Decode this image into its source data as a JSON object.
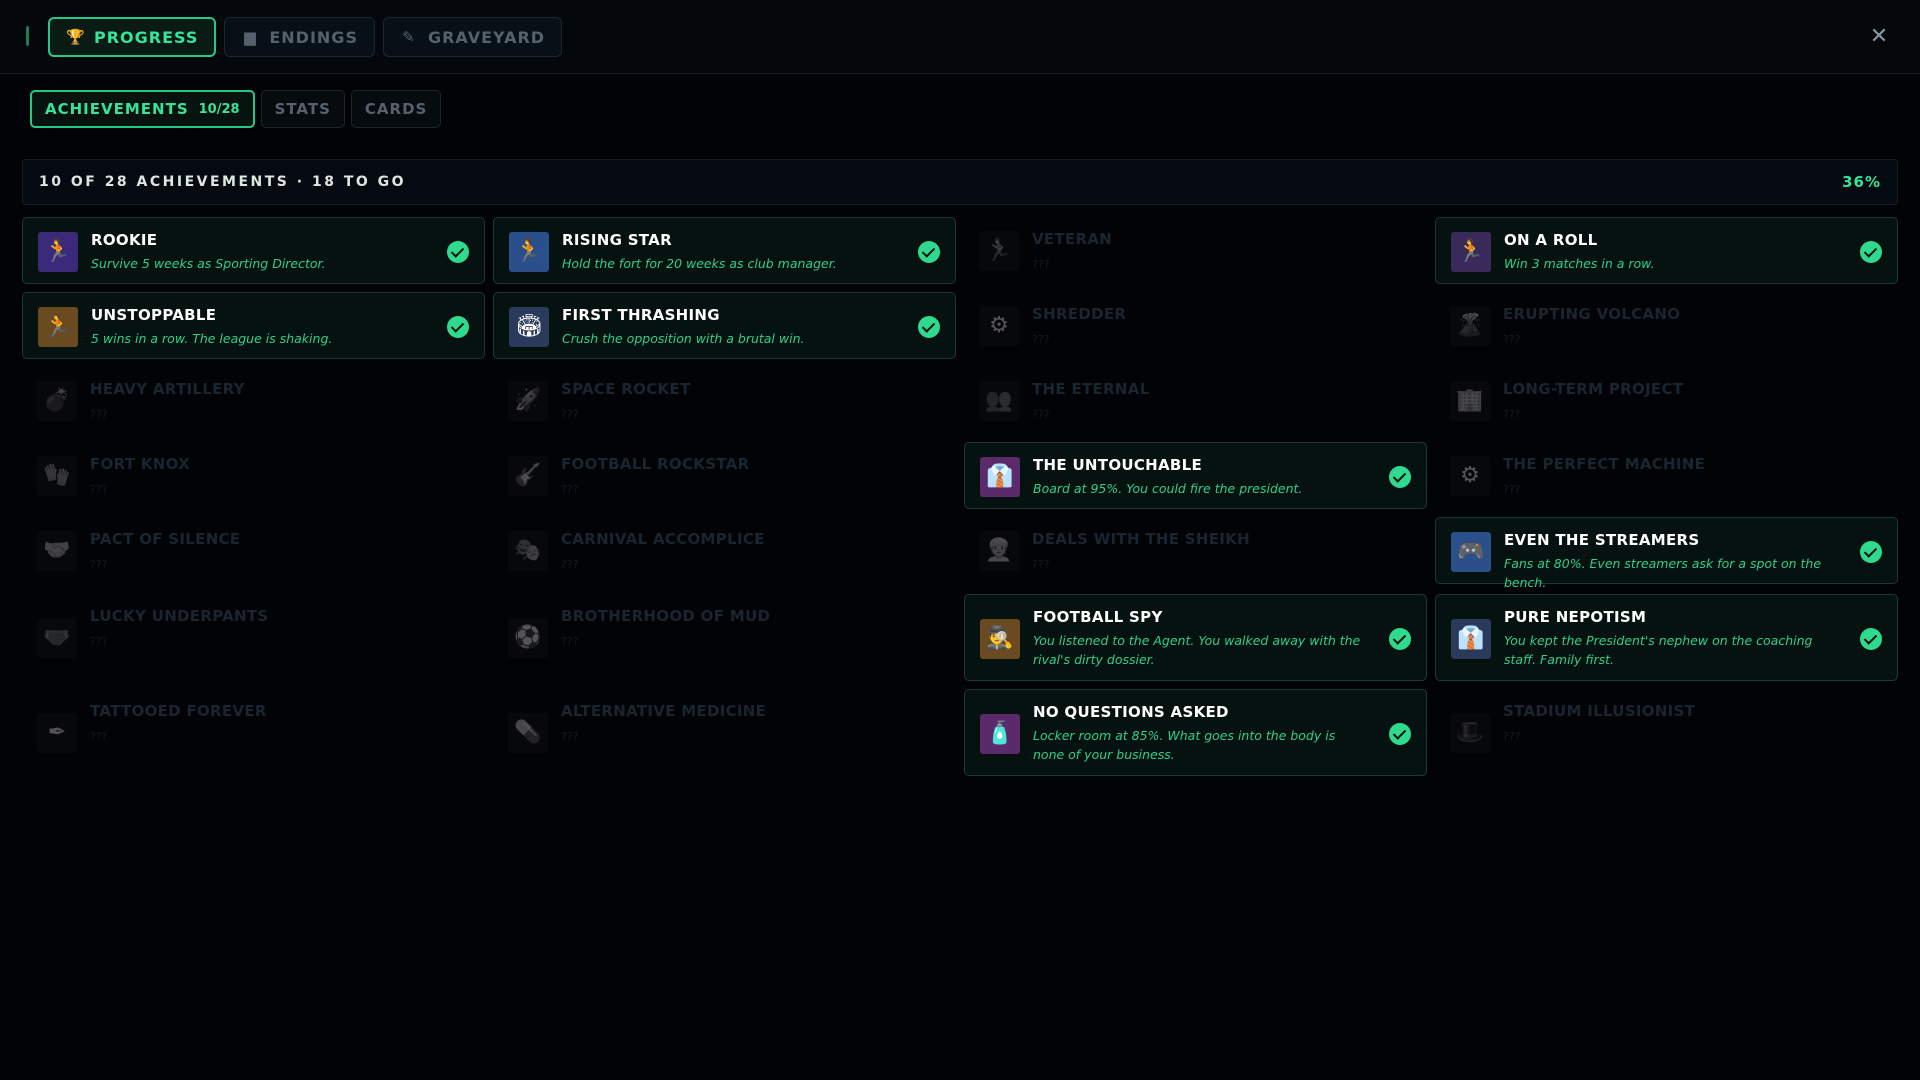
{
  "top_tabs": [
    {
      "label": "PROGRESS",
      "icon": "trophy-icon",
      "active": true
    },
    {
      "label": "ENDINGS",
      "icon": "book-icon",
      "active": false
    },
    {
      "label": "GRAVEYARD",
      "icon": "feather-icon",
      "active": false
    }
  ],
  "sub_tabs": [
    {
      "label": "ACHIEVEMENTS",
      "count": "10/28",
      "active": true
    },
    {
      "label": "STATS",
      "count": "",
      "active": false
    },
    {
      "label": "CARDS",
      "count": "",
      "active": false
    }
  ],
  "summary": {
    "text": "10 OF 28 ACHIEVEMENTS · 18 TO GO",
    "percent": "36%"
  },
  "progress": {
    "unlocked": 10,
    "total": 28,
    "fraction": 0.36
  },
  "colors": {
    "accent": "#35e49a",
    "check": "#2fd98d",
    "background": "#020306"
  },
  "achievements": [
    {
      "title": "ROOKIE",
      "desc": "Survive 5 weeks as Sporting Director.",
      "unlocked": true,
      "icon": "player-portrait"
    },
    {
      "title": "RISING STAR",
      "desc": "Hold the fort for 20 weeks as club manager.",
      "unlocked": true,
      "icon": "player-portrait"
    },
    {
      "title": "VETERAN",
      "desc": "???",
      "unlocked": false,
      "icon": "player-portrait"
    },
    {
      "title": "ON A ROLL",
      "desc": "Win 3 matches in a row.",
      "unlocked": true,
      "icon": "player-portrait"
    },
    {
      "title": "UNSTOPPABLE",
      "desc": "5 wins in a row. The league is shaking.",
      "unlocked": true,
      "icon": "player-portrait"
    },
    {
      "title": "FIRST THRASHING",
      "desc": "Crush the opposition with a brutal win.",
      "unlocked": true,
      "icon": "stadium-portrait"
    },
    {
      "title": "SHREDDER",
      "desc": "???",
      "unlocked": false,
      "icon": "machine-portrait"
    },
    {
      "title": "ERUPTING VOLCANO",
      "desc": "???",
      "unlocked": false,
      "icon": "volcano-portrait"
    },
    {
      "title": "HEAVY ARTILLERY",
      "desc": "???",
      "unlocked": false,
      "icon": "cannon-portrait"
    },
    {
      "title": "SPACE ROCKET",
      "desc": "???",
      "unlocked": false,
      "icon": "rocket-portrait"
    },
    {
      "title": "THE ETERNAL",
      "desc": "???",
      "unlocked": false,
      "icon": "team-portrait"
    },
    {
      "title": "LONG-TERM PROJECT",
      "desc": "???",
      "unlocked": false,
      "icon": "building-portrait"
    },
    {
      "title": "FORT KNOX",
      "desc": "???",
      "unlocked": false,
      "icon": "keeper-portrait"
    },
    {
      "title": "FOOTBALL ROCKSTAR",
      "desc": "???",
      "unlocked": false,
      "icon": "crowd-portrait"
    },
    {
      "title": "THE UNTOUCHABLE",
      "desc": "Board at 95%. You could fire the president.",
      "unlocked": true,
      "icon": "president-portrait"
    },
    {
      "title": "THE PERFECT MACHINE",
      "desc": "???",
      "unlocked": false,
      "icon": "machine-portrait"
    },
    {
      "title": "PACT OF SILENCE",
      "desc": "???",
      "unlocked": false,
      "icon": "handshake-portrait"
    },
    {
      "title": "CARNIVAL ACCOMPLICE",
      "desc": "???",
      "unlocked": false,
      "icon": "carnival-portrait"
    },
    {
      "title": "DEALS WITH THE SHEIKH",
      "desc": "???",
      "unlocked": false,
      "icon": "sheikh-portrait"
    },
    {
      "title": "EVEN THE STREAMERS",
      "desc": "Fans at 80%. Even streamers ask for a spot on the bench.",
      "unlocked": true,
      "icon": "streamer-portrait"
    },
    {
      "title": "LUCKY UNDERPANTS",
      "desc": "???",
      "unlocked": false,
      "icon": "underpants-portrait"
    },
    {
      "title": "BROTHERHOOD OF MUD",
      "desc": "???",
      "unlocked": false,
      "icon": "mud-portrait"
    },
    {
      "title": "FOOTBALL SPY",
      "desc": "You listened to the Agent. You walked away with the rival's dirty dossier.",
      "unlocked": true,
      "icon": "spy-portrait"
    },
    {
      "title": "PURE NEPOTISM",
      "desc": "You kept the President's nephew on the coaching staff. Family first.",
      "unlocked": true,
      "icon": "president-portrait"
    },
    {
      "title": "TATTOOED FOREVER",
      "desc": "???",
      "unlocked": false,
      "icon": "tattoo-portrait"
    },
    {
      "title": "ALTERNATIVE MEDICINE",
      "desc": "???",
      "unlocked": false,
      "icon": "medicine-portrait"
    },
    {
      "title": "NO QUESTIONS ASKED",
      "desc": "Locker room at 85%. What goes into the body is none of your business.",
      "unlocked": true,
      "icon": "bottle-portrait"
    },
    {
      "title": "STADIUM ILLUSIONIST",
      "desc": "???",
      "unlocked": false,
      "icon": "magician-portrait"
    }
  ]
}
